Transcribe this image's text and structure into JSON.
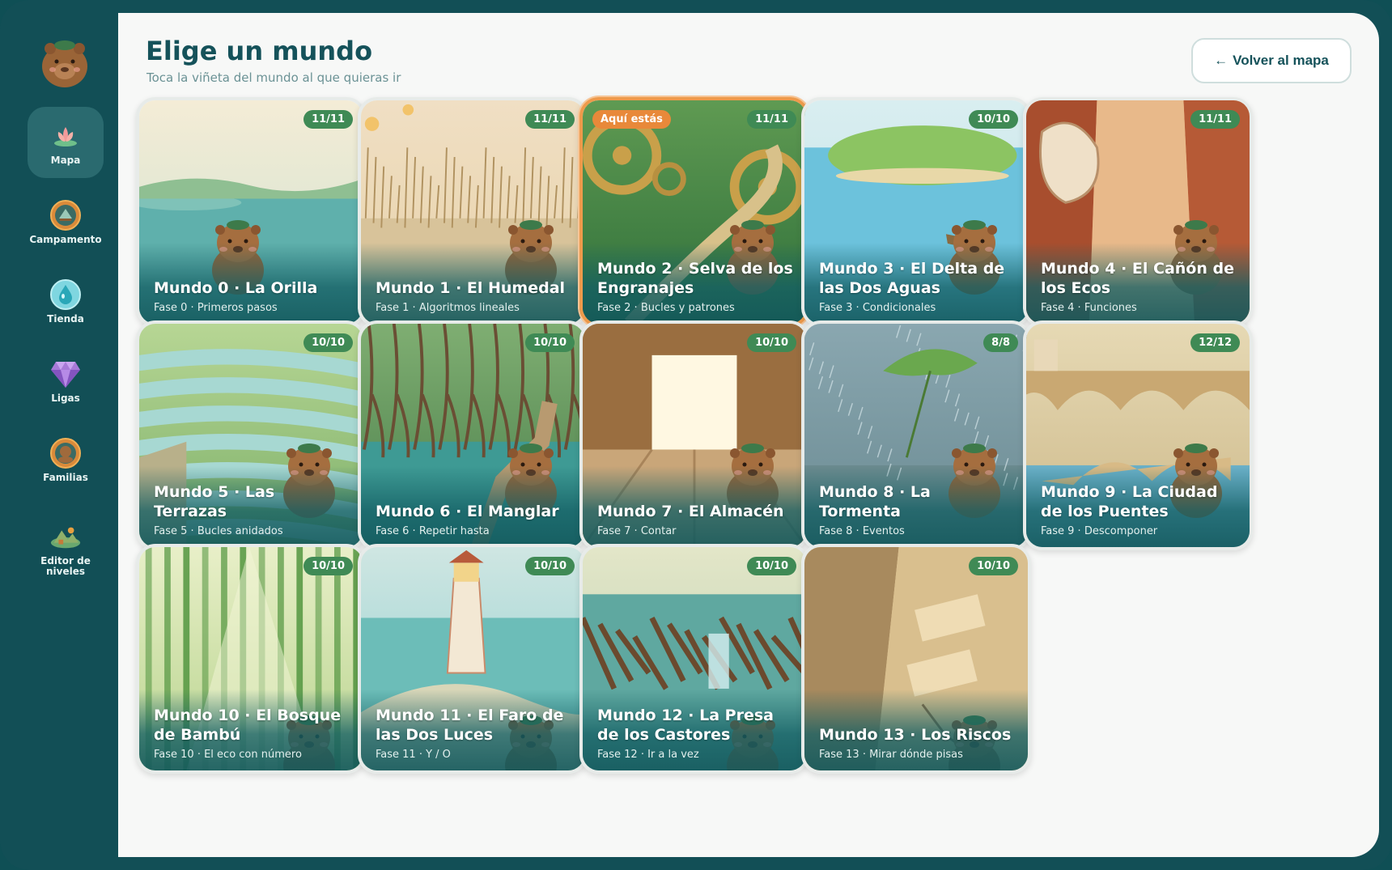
{
  "sidebar": {
    "items": [
      {
        "label": "Mapa",
        "icon": "lotus-icon",
        "active": true
      },
      {
        "label": "Campamento",
        "icon": "campfire-icon",
        "active": false
      },
      {
        "label": "Tienda",
        "icon": "drop-icon",
        "active": false
      },
      {
        "label": "Ligas",
        "icon": "gem-icon",
        "active": false
      },
      {
        "label": "Familias",
        "icon": "family-icon",
        "active": false
      },
      {
        "label": "Editor de niveles",
        "icon": "editor-icon",
        "active": false
      }
    ]
  },
  "header": {
    "title": "Elige un mundo",
    "subtitle": "Toca la viñeta del mundo al que quieras ir",
    "back_label": "Volver al mapa"
  },
  "current_badge": "Aquí estás",
  "worlds": [
    {
      "title": "Mundo 0 · La Orilla",
      "phase": "Fase 0 · Primeros pasos",
      "progress": "11/11",
      "theme": "lake"
    },
    {
      "title": "Mundo 1 · El Humedal",
      "phase": "Fase 1 · Algoritmos lineales",
      "progress": "11/11",
      "theme": "wetland"
    },
    {
      "title": "Mundo 2 · Selva de los Engranajes",
      "phase": "Fase 2 · Bucles y patrones",
      "progress": "11/11",
      "theme": "jungle",
      "current": true
    },
    {
      "title": "Mundo 3 · El Delta de las Dos Aguas",
      "phase": "Fase 3 · Condicionales",
      "progress": "10/10",
      "theme": "delta"
    },
    {
      "title": "Mundo 4 · El Cañón de los Ecos",
      "phase": "Fase 4 · Funciones",
      "progress": "11/11",
      "theme": "canyon"
    },
    {
      "title": "Mundo 5 · Las Terrazas",
      "phase": "Fase 5 · Bucles anidados",
      "progress": "10/10",
      "theme": "terraces"
    },
    {
      "title": "Mundo 6 · El Manglar",
      "phase": "Fase 6 · Repetir hasta",
      "progress": "10/10",
      "theme": "mangrove"
    },
    {
      "title": "Mundo 7 · El Almacén",
      "phase": "Fase 7 · Contar",
      "progress": "10/10",
      "theme": "warehouse"
    },
    {
      "title": "Mundo 8 · La Tormenta",
      "phase": "Fase 8 · Eventos",
      "progress": "8/8",
      "theme": "storm"
    },
    {
      "title": "Mundo 9 · La Ciudad de los Puentes",
      "phase": "Fase 9 · Descomponer",
      "progress": "12/12",
      "theme": "bridges"
    },
    {
      "title": "Mundo 10 · El Bosque de Bambú",
      "phase": "Fase 10 · El eco con número",
      "progress": "10/10",
      "theme": "bamboo"
    },
    {
      "title": "Mundo 11 · El Faro de las Dos Luces",
      "phase": "Fase 11 · Y / O",
      "progress": "10/10",
      "theme": "lighthouse"
    },
    {
      "title": "Mundo 12 · La Presa de los Castores",
      "phase": "Fase 12 · Ir a la vez",
      "progress": "10/10",
      "theme": "dam"
    },
    {
      "title": "Mundo 13 · Los Riscos",
      "phase": "Fase 13 · Mirar dónde pisas",
      "progress": "10/10",
      "theme": "cliffs"
    }
  ],
  "colors": {
    "sidebar": "#124f56",
    "accent": "#15525a",
    "badge": "#3f8a55",
    "current": "#e8893a"
  }
}
